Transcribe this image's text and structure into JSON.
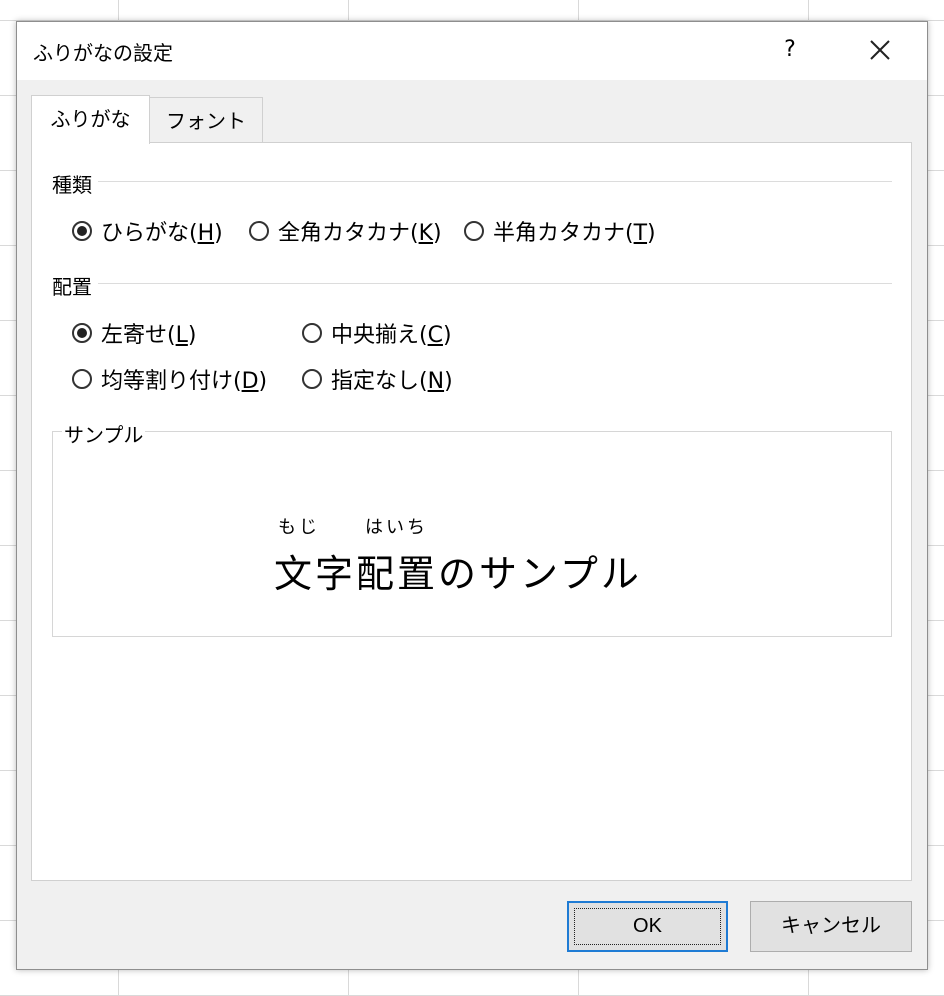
{
  "dialog": {
    "title": "ふりがなの設定",
    "help": "?",
    "close_icon": "close-icon"
  },
  "tabs": [
    {
      "label": "ふりがな",
      "active": true
    },
    {
      "label": "フォント",
      "active": false
    }
  ],
  "type_section": {
    "label": "種類",
    "options": [
      {
        "text": "ひらがな(",
        "key": "H",
        "close": ")",
        "selected": true
      },
      {
        "text": "全角カタカナ(",
        "key": "K",
        "close": ")",
        "selected": false
      },
      {
        "text": "半角カタカナ(",
        "key": "T",
        "close": ")",
        "selected": false
      }
    ]
  },
  "align_section": {
    "label": "配置",
    "options": [
      {
        "text": "左寄せ(",
        "key": "L",
        "close": ")",
        "selected": true
      },
      {
        "text": "中央揃え(",
        "key": "C",
        "close": ")",
        "selected": false
      },
      {
        "text": "均等割り付け(",
        "key": "D",
        "close": ")",
        "selected": false
      },
      {
        "text": "指定なし(",
        "key": "N",
        "close": ")",
        "selected": false
      }
    ]
  },
  "sample": {
    "label": "サンプル",
    "ruby_1": "もじ",
    "ruby_2": "はいち",
    "text": "文字配置のサンプル"
  },
  "buttons": {
    "ok": "OK",
    "cancel": "キャンセル"
  },
  "colors": {
    "focus_border": "#1e7bd4",
    "dialog_bg": "#f0f0f0"
  }
}
